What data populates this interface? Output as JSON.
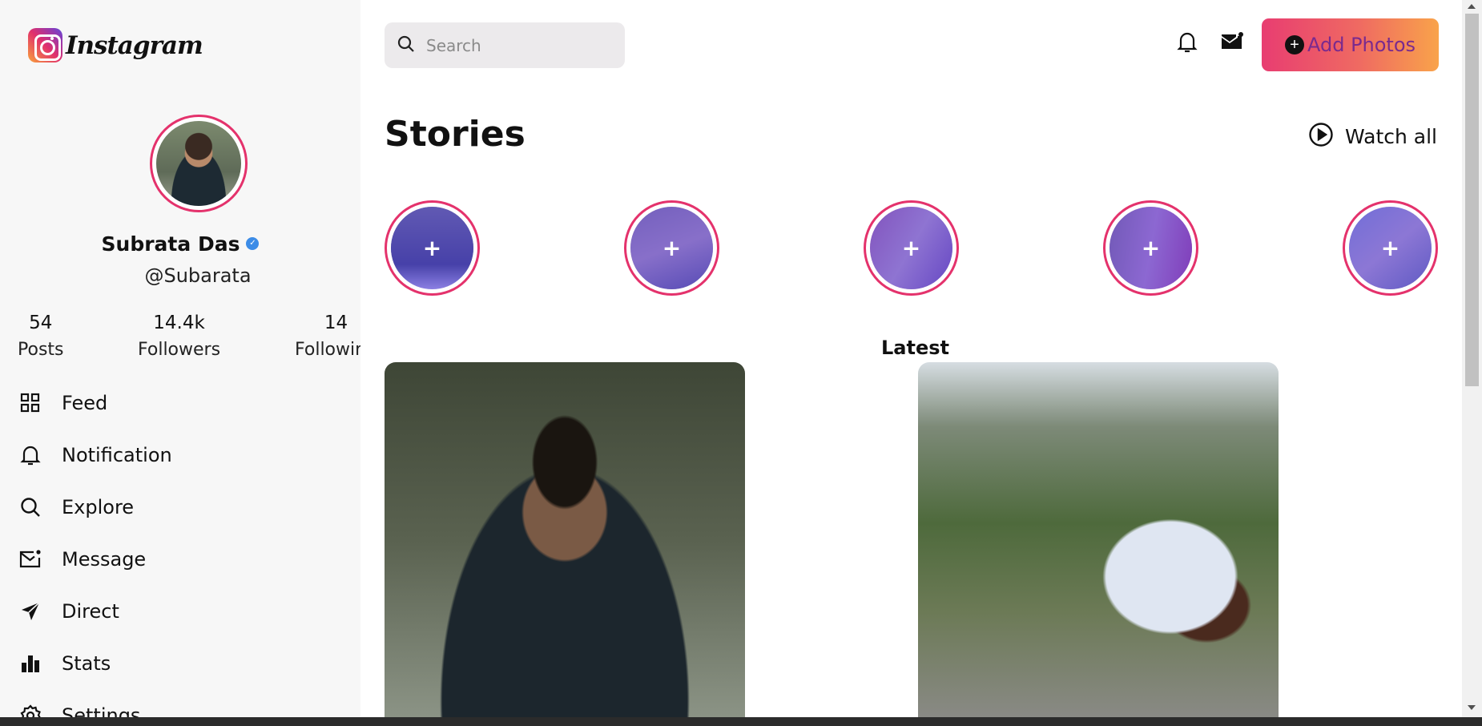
{
  "brand": {
    "name": "Instagram",
    "logo_icon": "instagram-logo-icon"
  },
  "profile": {
    "name": "Subrata Das",
    "handle": "@Subarata",
    "verified_icon": "verified-check-icon",
    "stats": [
      {
        "value": "54",
        "label": "Posts"
      },
      {
        "value": "14.4k",
        "label": "Followers"
      },
      {
        "value": "14",
        "label": "Following"
      }
    ]
  },
  "nav": {
    "items": [
      {
        "label": "Feed",
        "icon": "grid-icon"
      },
      {
        "label": "Notification",
        "icon": "bell-icon"
      },
      {
        "label": "Explore",
        "icon": "search-icon"
      },
      {
        "label": "Message",
        "icon": "mail-icon"
      },
      {
        "label": "Direct",
        "icon": "send-icon"
      },
      {
        "label": "Stats",
        "icon": "bar-chart-icon"
      },
      {
        "label": "Settings",
        "icon": "gear-icon"
      }
    ]
  },
  "header": {
    "search_placeholder": "Search",
    "add_button_label": "Add Photos",
    "icons": [
      "bell-icon",
      "mail-icon",
      "plus-circle-icon"
    ]
  },
  "stories": {
    "title": "Stories",
    "watch_all_label": "Watch all",
    "add_symbol": "+",
    "count": 5
  },
  "feed": {
    "latest_label": "Latest"
  },
  "colors": {
    "accent_pink": "#e4326c",
    "button_gradient_start": "#e83d71",
    "button_gradient_end": "#f9a34a",
    "button_text": "#7a2a8e",
    "sidebar_bg": "#f7f7f7",
    "story_tint": "#5846e6"
  }
}
